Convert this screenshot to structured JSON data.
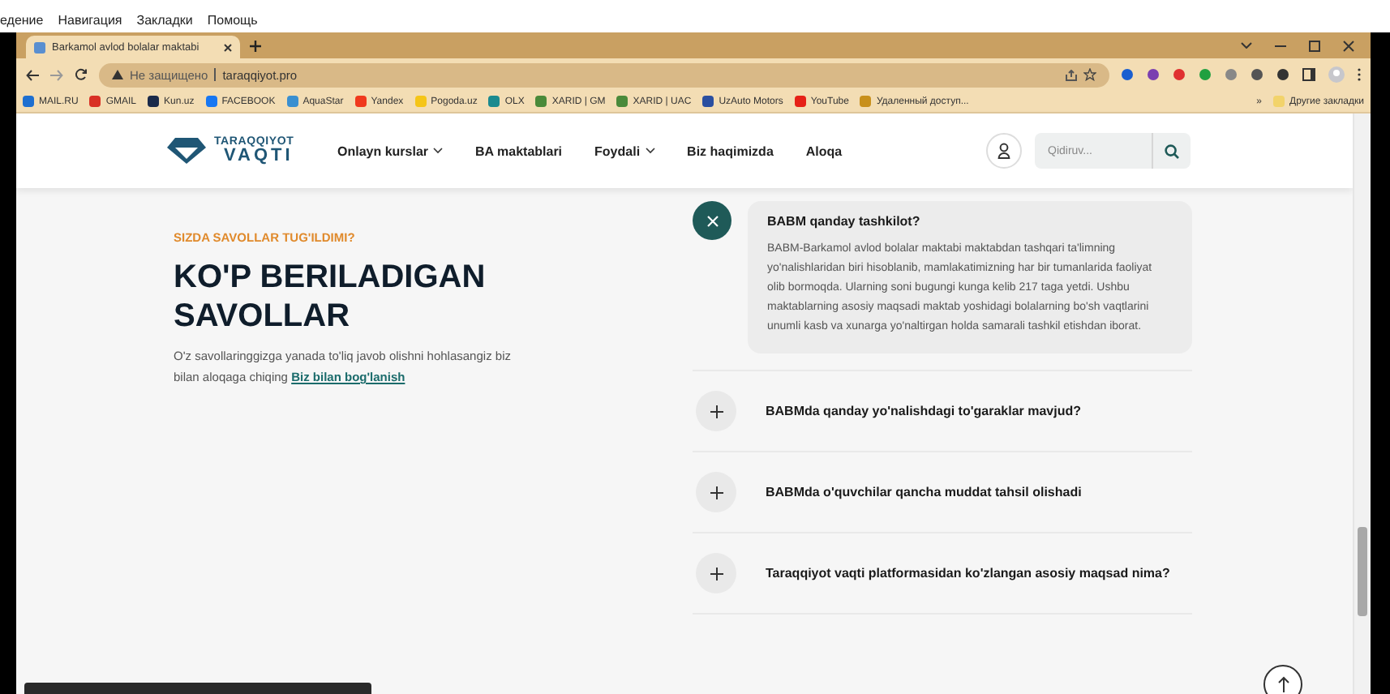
{
  "menu_bar": [
    "едение",
    "Навигация",
    "Закладки",
    "Помощь"
  ],
  "browser": {
    "tab": {
      "title": "Barkamol avlod bolalar maktabi",
      "selected": true
    },
    "address": {
      "security": "Не защищено",
      "url": "taraqqiyot.pro"
    },
    "bookmarks": [
      {
        "label": "MAIL.RU",
        "color": "#1e6fd0"
      },
      {
        "label": "GMAIL",
        "color": "#d93025"
      },
      {
        "label": "Kun.uz",
        "color": "#1a2a4a"
      },
      {
        "label": "FACEBOOK",
        "color": "#1877f2"
      },
      {
        "label": "AquaStar",
        "color": "#3a8fd0"
      },
      {
        "label": "Yandex",
        "color": "#f0391d"
      },
      {
        "label": "Pogoda.uz",
        "color": "#f5c518"
      },
      {
        "label": "OLX",
        "color": "#1b8a8f"
      },
      {
        "label": "XARID | GM",
        "color": "#4a8a3a"
      },
      {
        "label": "XARID | UAC",
        "color": "#4a8a3a"
      },
      {
        "label": "UzAuto Motors",
        "color": "#2b4fa0"
      },
      {
        "label": "YouTube",
        "color": "#e62117"
      },
      {
        "label": "Удаленный доступ...",
        "color": "#c8901c"
      }
    ],
    "more": "»",
    "other_bookmarks": "Другие закладки"
  },
  "site": {
    "logo": {
      "line1": "TARAQQIYOT",
      "line2": "VAQTI"
    },
    "nav": [
      {
        "label": "Onlayn kurslar",
        "dropdown": true
      },
      {
        "label": "BA maktablari",
        "dropdown": false
      },
      {
        "label": "Foydali",
        "dropdown": true
      },
      {
        "label": "Biz haqimizda",
        "dropdown": false
      },
      {
        "label": "Aloqa",
        "dropdown": false
      }
    ],
    "search": {
      "placeholder": "Qidiruv..."
    }
  },
  "intro": {
    "eyebrow": "SIZDA SAVOLLAR TUG'ILDIMI?",
    "title": "KO'P BERILADIGAN SAVOLLAR",
    "text": "O'z savollaringgizga yanada to'liq javob olishni hohlasangiz biz bilan aloqaga chiqing",
    "link": "Biz bilan bog'lanish"
  },
  "faq": [
    {
      "question": "BABM qanday tashkilot?",
      "expanded": true,
      "answer": "BABM-Barkamol avlod bolalar maktabi maktabdan tashqari ta'limning yo'nalishlaridan biri hisoblanib, mamlakatimizning har bir tumanlarida faoliyat olib bormoqda. Ularning soni bugungi kunga kelib 217 taga yetdi. Ushbu maktablarning asosiy maqsadi maktab yoshidagi bolalarning bo'sh vaqtlarini unumli kasb va xunarga yo'naltirgan holda samarali tashkil etishdan iborat."
    },
    {
      "question": "BABMda qanday yo'nalishdagi to'garaklar mavjud?",
      "expanded": false
    },
    {
      "question": "BABMda o'quvchilar qancha muddat tahsil olishadi",
      "expanded": false
    },
    {
      "question": "Taraqqiyot vaqti platformasidan ko'zlangan asosiy maqsad nima?",
      "expanded": false
    }
  ]
}
